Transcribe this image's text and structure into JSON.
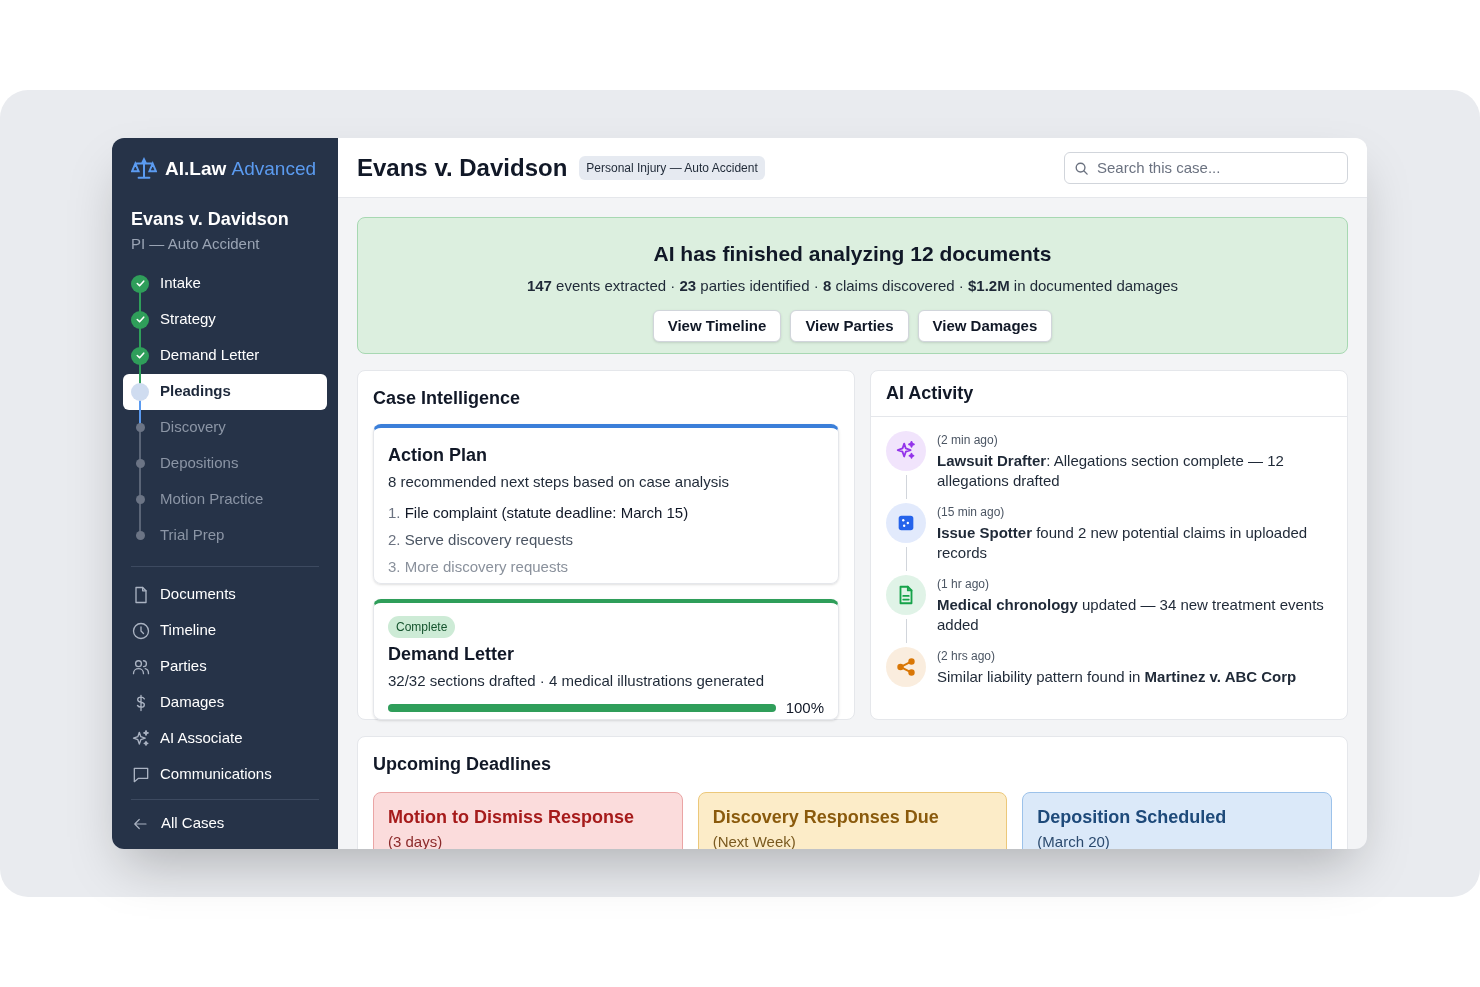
{
  "brand": {
    "name": "AI.Law",
    "edition": "Advanced"
  },
  "case": {
    "title": "Evans v. Davidson",
    "subtitle": "PI — Auto Accident"
  },
  "stages": [
    {
      "label": "Intake",
      "done": true,
      "selected": false
    },
    {
      "label": "Strategy",
      "done": true,
      "selected": false
    },
    {
      "label": "Demand Letter",
      "done": true,
      "selected": false
    },
    {
      "label": "Pleadings",
      "done": false,
      "selected": true
    },
    {
      "label": "Discovery",
      "done": false,
      "selected": false
    },
    {
      "label": "Depositions",
      "done": false,
      "selected": false
    },
    {
      "label": "Motion Practice",
      "done": false,
      "selected": false
    },
    {
      "label": "Trial Prep",
      "done": false,
      "selected": false
    }
  ],
  "nav": [
    {
      "kind": "document",
      "label": "Documents"
    },
    {
      "kind": "clock",
      "label": "Timeline"
    },
    {
      "kind": "users",
      "label": "Parties"
    },
    {
      "kind": "dollar",
      "label": "Damages"
    },
    {
      "kind": "sparkle",
      "label": "AI Associate"
    },
    {
      "kind": "chat",
      "label": "Communications"
    }
  ],
  "back_link": "All Cases",
  "header": {
    "title": "Evans v. Davidson",
    "tag": "Personal Injury — Auto Accident",
    "search": {
      "placeholder": "Search this case..."
    }
  },
  "banner": {
    "title": "AI has finished analyzing 12 documents",
    "summary": "**147** events extracted · **23** parties identified · **8** claims discovered · **$1.2M** in documented damages",
    "buttons": [
      "View Timeline",
      "View Parties",
      "View Damages"
    ]
  },
  "case_intelligence": {
    "title": "Case Intelligence",
    "action_plan": {
      "title": "Action Plan",
      "subtitle": "8 recommended next steps based on case analysis",
      "steps": [
        {
          "number": "1.",
          "text": "File complaint (statute deadline: March 15)",
          "faded": false
        },
        {
          "number": "2.",
          "text": "Serve discovery requests",
          "faded": false
        },
        {
          "number": "3.",
          "text": "More discovery requests",
          "faded": true
        }
      ]
    },
    "demand_letter": {
      "badge": "Complete",
      "title": "Demand Letter",
      "detail": "32/32 sections drafted · 4 medical illustrations generated",
      "level": 1,
      "reading": "100%"
    }
  },
  "ai_activity": {
    "title": "AI Activity",
    "items": [
      {
        "kind": "sparkle",
        "color": "#9333ea",
        "time": "(2 min ago)",
        "text": "**Lawsuit Drafter**: Allegations section complete — 12 allegations drafted"
      },
      {
        "kind": "puzzle",
        "color": "#2563eb",
        "time": "(15 min ago)",
        "text": "**Issue Spotter** found 2 new potential claims in uploaded records"
      },
      {
        "kind": "document",
        "color": "#16a34a",
        "time": "(1 hr ago)",
        "text": "**Medical chronology** updated — 34 new treatment events added"
      },
      {
        "kind": "share",
        "color": "#d97706",
        "time": "(2 hrs ago)",
        "text": "Similar liability pattern found in **Martinez v. ABC Corp**"
      }
    ]
  },
  "deadlines": {
    "title": "Upcoming Deadlines",
    "items": [
      {
        "kind": "urgent",
        "title": "Motion to Dismiss Response",
        "when": "(3 days)"
      },
      {
        "kind": "soon",
        "title": "Discovery Responses Due",
        "when": "(Next Week)"
      },
      {
        "kind": "scheduled",
        "title": "Deposition Scheduled",
        "when": "(March 20)"
      }
    ]
  }
}
